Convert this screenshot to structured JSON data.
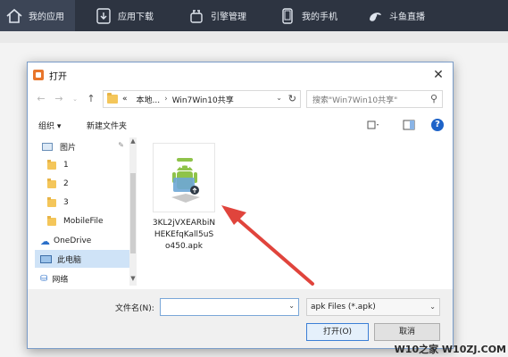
{
  "app_nav": [
    {
      "label": "我的应用",
      "icon": "home-icon"
    },
    {
      "label": "应用下载",
      "icon": "download-icon"
    },
    {
      "label": "引擎管理",
      "icon": "engine-icon"
    },
    {
      "label": "我的手机",
      "icon": "phone-icon"
    },
    {
      "label": "斗鱼直播",
      "icon": "douyu-icon"
    }
  ],
  "dialog": {
    "title": "打开",
    "address": {
      "crumb1": "«",
      "crumb2": "本地...",
      "crumb3": "Win7Win10共享"
    },
    "search_placeholder": "搜索\"Win7Win10共享\"",
    "toolbar": {
      "organize": "组织 ▾",
      "new_folder": "新建文件夹"
    },
    "sidebar": [
      {
        "label": "图片",
        "icon": "pictures-icon"
      },
      {
        "label": "1",
        "icon": "folder-icon"
      },
      {
        "label": "2",
        "icon": "folder-icon"
      },
      {
        "label": "3",
        "icon": "folder-icon"
      },
      {
        "label": "MobileFile",
        "icon": "folder-icon"
      },
      {
        "label": "OneDrive",
        "icon": "cloud-icon"
      },
      {
        "label": "此电脑",
        "icon": "computer-icon"
      },
      {
        "label": "网络",
        "icon": "network-icon"
      }
    ],
    "file": {
      "name": "3KL2jVXEARbiNHEKEfqKall5uSo450.apk",
      "line1": "3KL2jVXEARbiN",
      "line2": "HEKEfqKall5uS",
      "line3": "o450.apk"
    },
    "filename_label": "文件名(N):",
    "filename_value": "",
    "filter_value": "apk Files (*.apk)",
    "open_button": "打开(O)",
    "cancel_button": "取消"
  },
  "watermark": "W10之家 W10ZJ.COM",
  "colors": {
    "topbar": "#2d3441",
    "accent": "#1e63c8",
    "arrow": "#e0443c",
    "android_green": "#8fc34a"
  }
}
